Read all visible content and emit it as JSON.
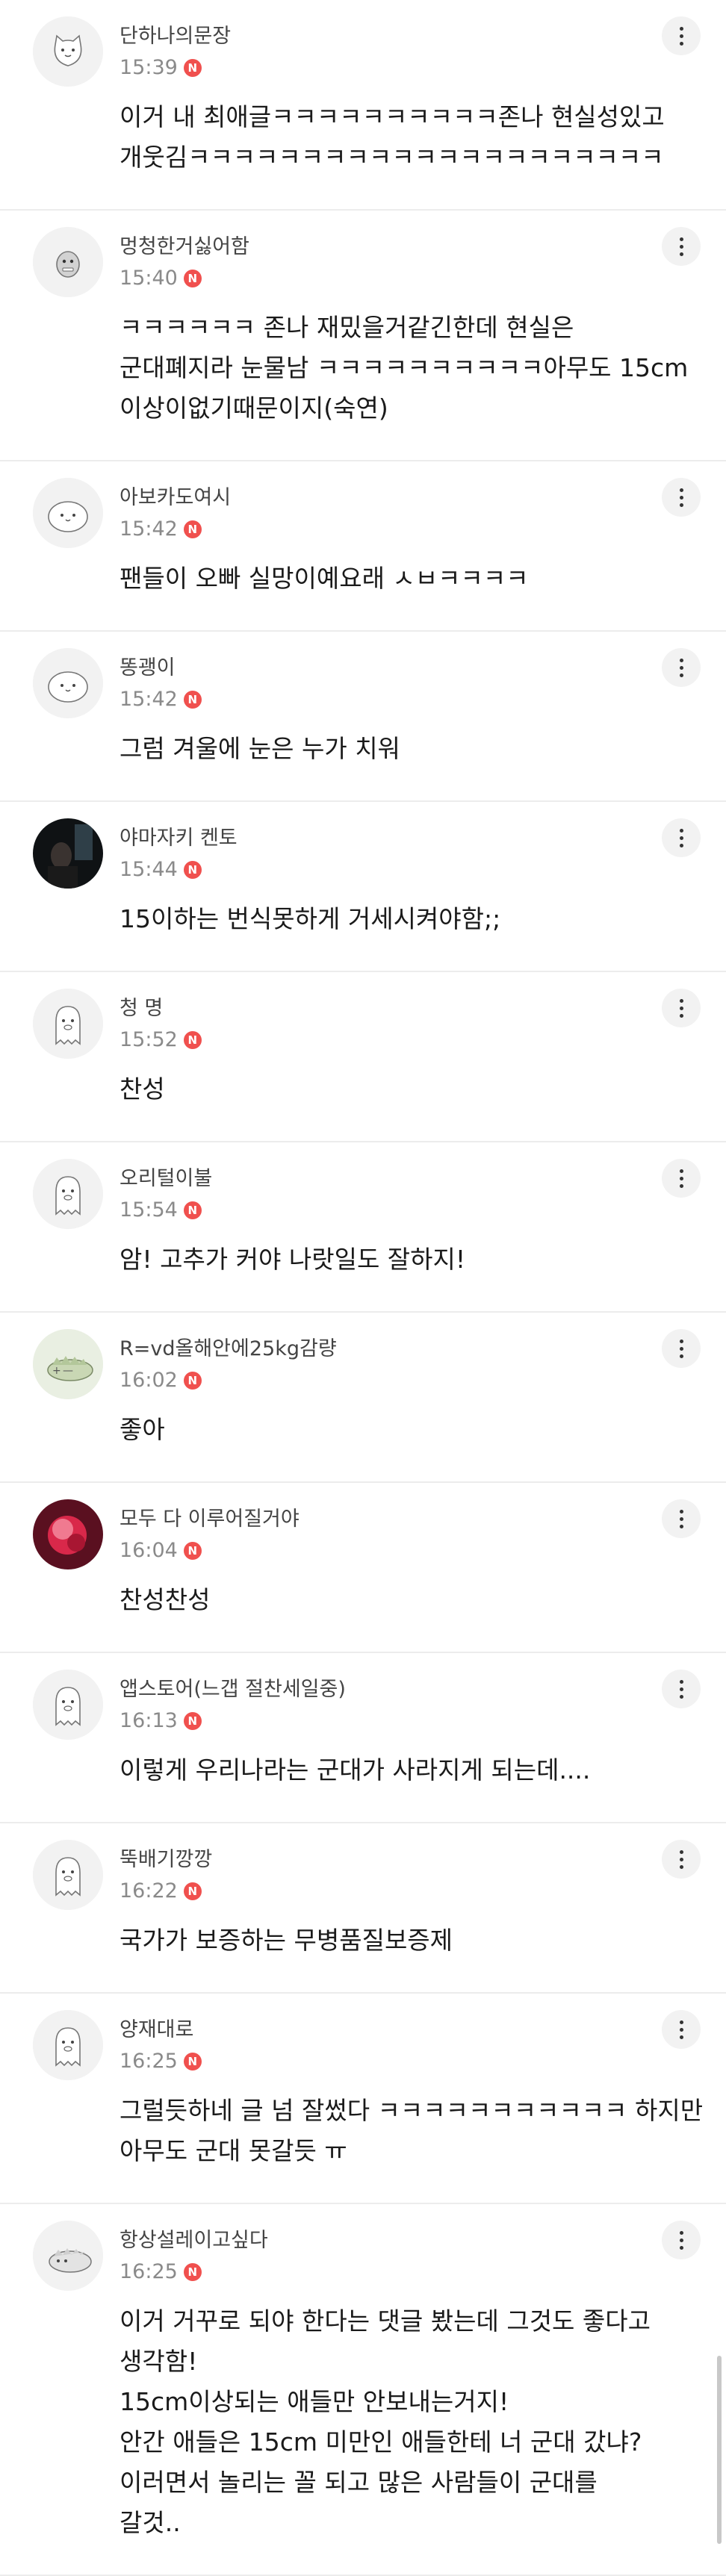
{
  "comments": [
    {
      "avatar": "white-cat-icon",
      "nickname": "단하나의문장",
      "time": "15:39",
      "badge": "N",
      "lines": [
        "이거 내 최애글ㅋㅋㅋㅋㅋㅋㅋㅋㅋㅋ존나 현실성있고",
        "개웃김ㅋㅋㅋㅋㅋㅋㅋㅋㅋㅋㅋㅋㅋㅋㅋㅋㅋㅋㅋㅋㅋ"
      ]
    },
    {
      "avatar": "grey-monster-icon",
      "nickname": "멍청한거싫어함",
      "time": "15:40",
      "badge": "N",
      "lines": [
        "ㅋㅋㅋㅋㅋㅋ 존나 재밌을거같긴한데 현실은",
        "군대폐지라 눈물남 ㅋㅋㅋㅋㅋㅋㅋㅋㅋㅋ아무도 15cm",
        "이상이없기때문이지(숙연)"
      ]
    },
    {
      "avatar": "white-blob-icon",
      "nickname": "아보카도여시",
      "time": "15:42",
      "badge": "N",
      "lines": [
        "팬들이 오빠 실망이예요래 ㅅㅂㅋㅋㅋㅋ"
      ]
    },
    {
      "avatar": "white-blob-icon",
      "nickname": "똥괭이",
      "time": "15:42",
      "badge": "N",
      "lines": [
        "그럼 겨울에 눈은 누가 치워"
      ]
    },
    {
      "avatar": "dark-photo-icon",
      "nickname": "야마자키 켄토",
      "time": "15:44",
      "badge": "N",
      "lines": [
        "15이하는 번식못하게 거세시켜야함;;"
      ]
    },
    {
      "avatar": "grey-ghost-icon",
      "nickname": "청 명",
      "time": "15:52",
      "badge": "N",
      "lines": [
        "찬성"
      ]
    },
    {
      "avatar": "grey-ghost-icon",
      "nickname": "오리털이불",
      "time": "15:54",
      "badge": "N",
      "lines": [
        "암! 고추가 커야 나랏일도 잘하지!"
      ]
    },
    {
      "avatar": "green-dino-icon",
      "nickname": "R=vd올해안에25kg감량",
      "time": "16:02",
      "badge": "N",
      "lines": [
        "좋아"
      ]
    },
    {
      "avatar": "pink-photo-icon",
      "nickname": "모두 다 이루어질거야",
      "time": "16:04",
      "badge": "N",
      "lines": [
        "찬성찬성"
      ]
    },
    {
      "avatar": "grey-ghost-icon",
      "nickname": "앱스토어(느갭 절찬세일중)",
      "time": "16:13",
      "badge": "N",
      "lines": [
        "이렇게 우리나라는 군대가 사라지게 되는데...."
      ]
    },
    {
      "avatar": "grey-ghost-icon",
      "nickname": "뚝배기깡깡",
      "time": "16:22",
      "badge": "N",
      "lines": [
        "국가가 보증하는 무병품질보증제"
      ]
    },
    {
      "avatar": "grey-ghost-icon",
      "nickname": "양재대로",
      "time": "16:25",
      "badge": "N",
      "lines": [
        "그럴듯하네 글 넘 잘썼다 ㅋㅋㅋㅋㅋㅋㅋㅋㅋㅋㅋ 하지만",
        "아무도 군대 못갈듯 ㅠ"
      ]
    },
    {
      "avatar": "grey-dino-icon",
      "nickname": "항상설레이고싶다",
      "time": "16:25",
      "badge": "N",
      "lines": [
        "이거 거꾸로 되야 한다는 댓글 봤는데 그것도 좋다고",
        "생각함!",
        "15cm이상되는 애들만 안보내는거지!",
        "안간 애들은 15cm 미만인 애들한테 너 군대 갔냐?",
        "이러면서 놀리는 꼴 되고 많은 사람들이 군대를",
        "갈것.."
      ]
    }
  ]
}
